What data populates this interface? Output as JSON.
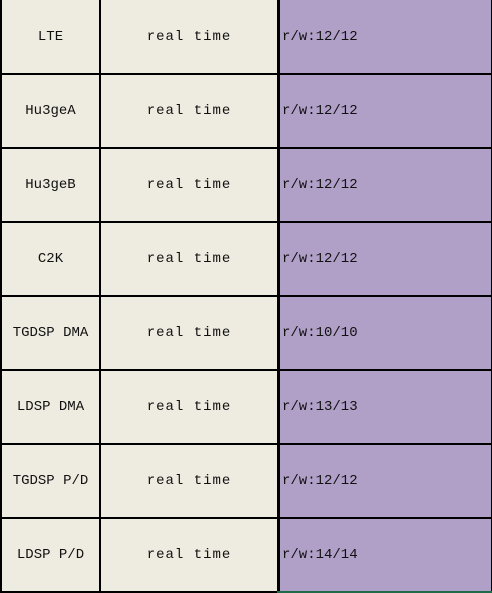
{
  "rows": [
    {
      "name": "LTE",
      "mode": "real time",
      "rw": "r/w:12/12"
    },
    {
      "name": "Hu3geA",
      "mode": "real time",
      "rw": "r/w:12/12"
    },
    {
      "name": "Hu3geB",
      "mode": "real time",
      "rw": "r/w:12/12"
    },
    {
      "name": "C2K",
      "mode": "real time",
      "rw": "r/w:12/12"
    },
    {
      "name": "TGDSP DMA",
      "mode": "real time",
      "rw": "r/w:10/10"
    },
    {
      "name": "LDSP DMA",
      "mode": "real time",
      "rw": "r/w:13/13"
    },
    {
      "name": "TGDSP P/D",
      "mode": "real time",
      "rw": "r/w:12/12"
    },
    {
      "name": "LDSP P/D",
      "mode": "real time",
      "rw": "r/w:14/14"
    }
  ],
  "colors": {
    "label_bg": "#EEEBE0",
    "value_bg": "#B0A0C8",
    "grid": "#000000"
  }
}
